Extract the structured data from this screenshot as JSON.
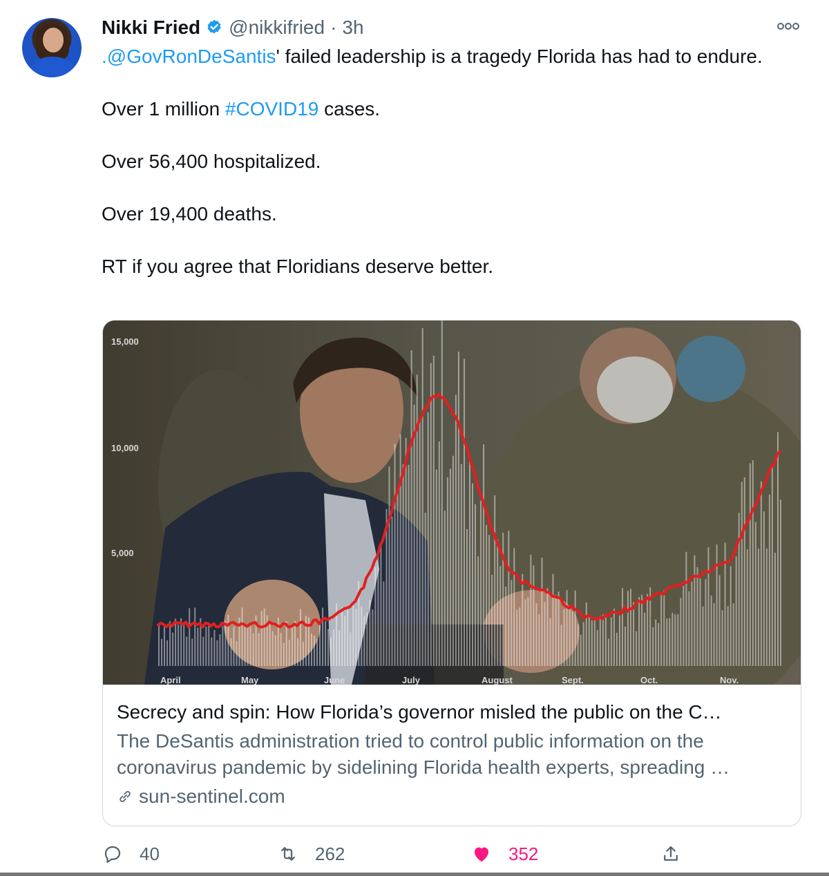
{
  "author": {
    "display_name": "Nikki Fried",
    "handle": "@nikkifried",
    "separator": "·",
    "time": "3h"
  },
  "tweet": {
    "line1_mention": ".@GovRonDeSantis",
    "line1_rest": "' failed leadership is a tragedy Florida has had to endure.",
    "line2_prefix": "Over 1 million ",
    "line2_hashtag": "#COVID19",
    "line2_suffix": " cases.",
    "line3": "Over 56,400 hospitalized.",
    "line4": "Over 19,400 deaths.",
    "line5": "RT if you agree that Floridians deserve better."
  },
  "card": {
    "y_labels": [
      "15,000",
      "10,000",
      "5,000"
    ],
    "x_labels": [
      "April",
      "May",
      "June",
      "July",
      "August",
      "Sept.",
      "Oct.",
      "Nov."
    ],
    "title": "Secrecy and spin: How Florida’s governor misled the public on the C…",
    "description": "The DeSantis administration tried to control public information on the coronavirus pandemic by sidelining Florida health experts, spreading …",
    "domain": "sun-sentinel.com"
  },
  "actions": {
    "reply_count": "40",
    "retweet_count": "262",
    "like_count": "352"
  },
  "colors": {
    "accent": "#1d9bf0",
    "like": "#f91880",
    "muted": "#536471",
    "trend_line": "#e02020"
  },
  "icons": [
    "verified-icon",
    "more-icon",
    "link-icon",
    "reply-icon",
    "retweet-icon",
    "like-icon",
    "share-icon"
  ]
}
